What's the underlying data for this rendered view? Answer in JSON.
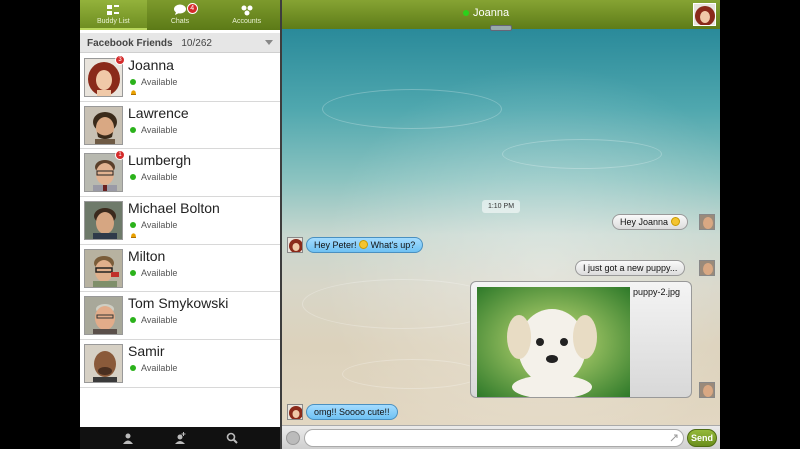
{
  "tabs": [
    {
      "label": "Buddy List",
      "icon": "buddy-list-icon",
      "active": true
    },
    {
      "label": "Chats",
      "icon": "chats-icon",
      "badge": "4"
    },
    {
      "label": "Accounts",
      "icon": "accounts-icon"
    }
  ],
  "buddy_header": {
    "title": "Facebook Friends",
    "count": "10/262"
  },
  "buddies": [
    {
      "name": "Joanna",
      "status": "Available",
      "badge": "3",
      "alert": true
    },
    {
      "name": "Lawrence",
      "status": "Available"
    },
    {
      "name": "Lumbergh",
      "status": "Available",
      "badge": "1"
    },
    {
      "name": "Michael Bolton",
      "status": "Available",
      "alert": true
    },
    {
      "name": "Milton",
      "status": "Available"
    },
    {
      "name": "Tom Smykowski",
      "status": "Available"
    },
    {
      "name": "Samir",
      "status": "Available"
    }
  ],
  "bottom_bar": [
    "person-icon",
    "add-person-icon",
    "search-icon"
  ],
  "chat": {
    "title": "Joanna",
    "timestamp": "1:10 PM",
    "messages": [
      {
        "dir": "out",
        "text": "Hey Joanna",
        "smiley": true
      },
      {
        "dir": "in",
        "text": "Hey Peter!",
        "text2": "What's up?",
        "smiley": true
      },
      {
        "dir": "out",
        "text": "I just got a new puppy..."
      },
      {
        "dir": "out",
        "type": "image",
        "filename": "puppy-2.jpg"
      },
      {
        "dir": "in",
        "text": "omg!! Soooo cute!!"
      }
    ]
  },
  "compose": {
    "placeholder": "",
    "send_label": "Send"
  },
  "colors": {
    "accent": "#6f8e22",
    "incoming": "#6ec1f3",
    "badge": "#d42a2a",
    "online": "#2bb21b"
  }
}
